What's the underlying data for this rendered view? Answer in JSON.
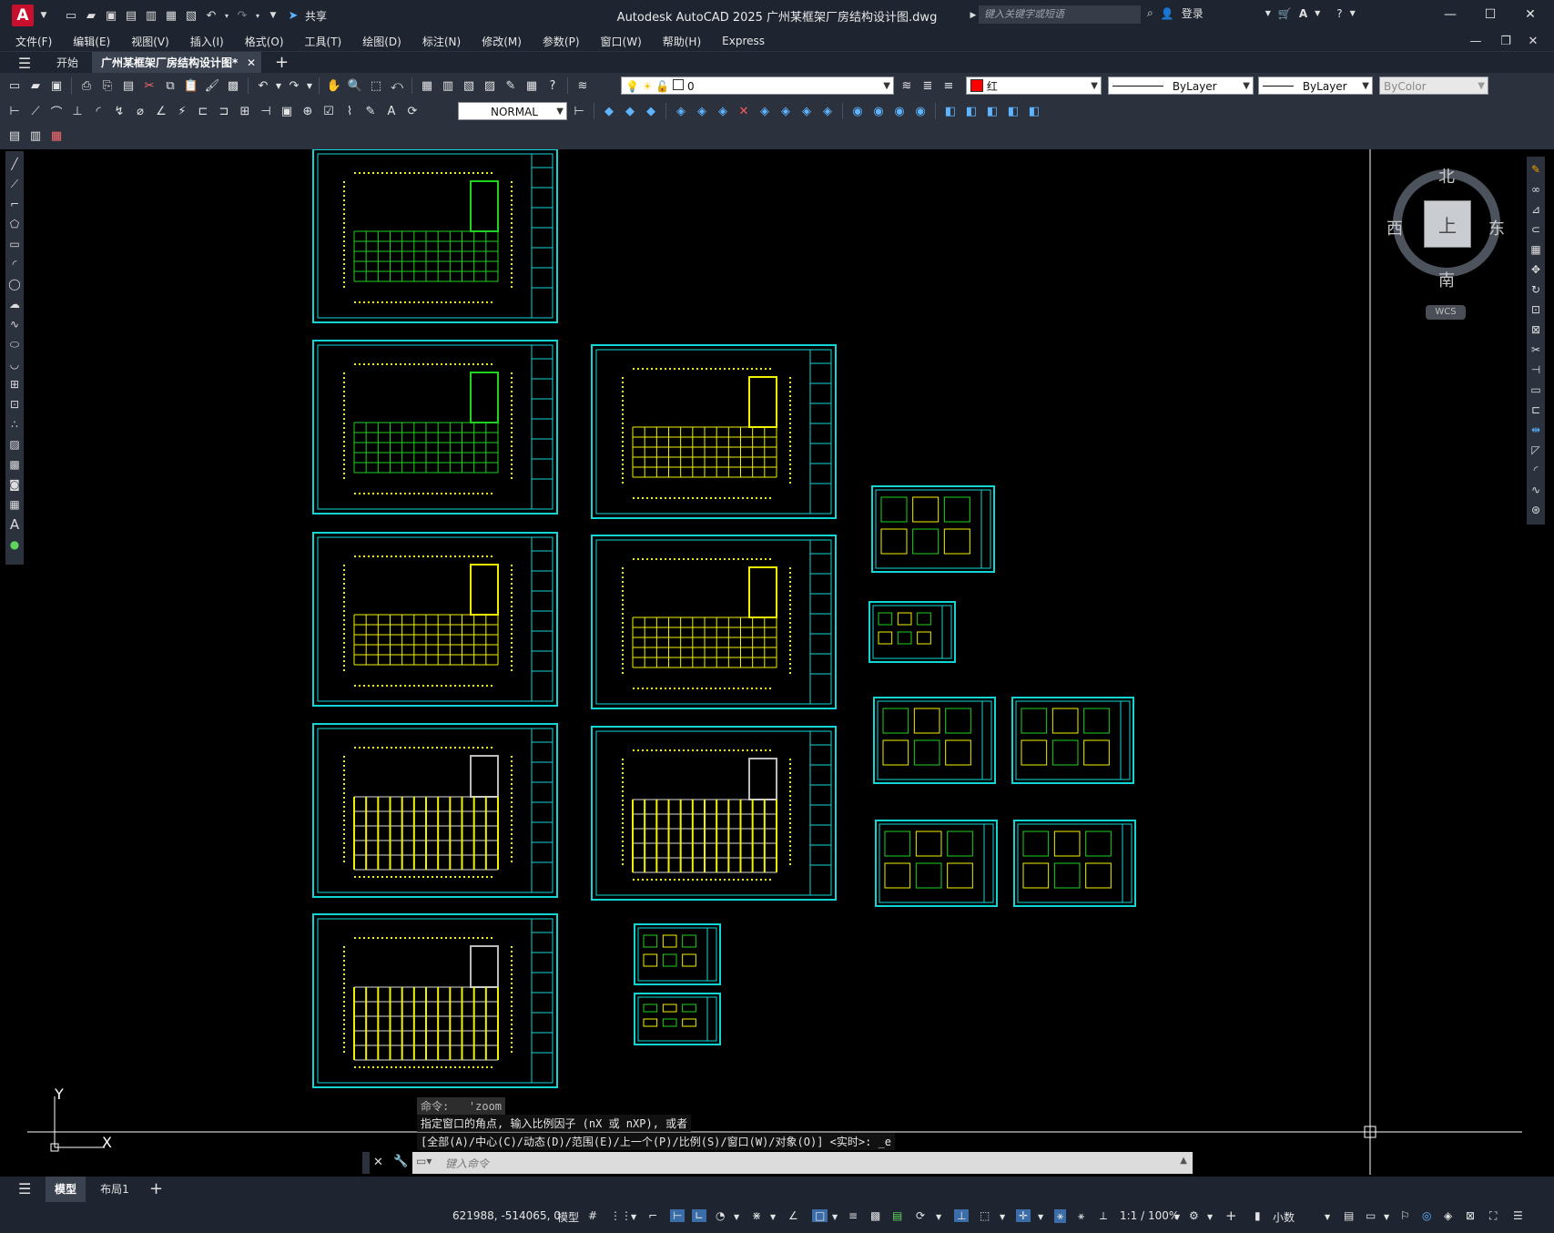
{
  "app": {
    "logo_letter": "A",
    "title": "Autodesk AutoCAD 2025    广州某框架厂房结构设计图.dwg",
    "share_label": "共享",
    "search_placeholder": "键入关键字或短语",
    "login_label": "登录"
  },
  "menu": [
    "文件(F)",
    "编辑(E)",
    "视图(V)",
    "插入(I)",
    "格式(O)",
    "工具(T)",
    "绘图(D)",
    "标注(N)",
    "修改(M)",
    "参数(P)",
    "窗口(W)",
    "帮助(H)",
    "Express"
  ],
  "tabs": {
    "start": "开始",
    "doc": "广州某框架厂房结构设计图*",
    "add": "+"
  },
  "properties": {
    "layer_value": "0",
    "color_value": "红",
    "color_hex": "#ff0000",
    "linetype_value": "ByLayer",
    "lineweight_value": "ByLayer",
    "plotstyle_value": "ByColor",
    "dimstyle_value": "NORMAL"
  },
  "viewcube": {
    "north": "北",
    "south": "南",
    "west": "西",
    "east": "东",
    "face": "上",
    "wcs": "WCS"
  },
  "ucs": {
    "y_label": "Y",
    "x_label": "X"
  },
  "command": {
    "line1": "命令:   'zoom",
    "line2": "指定窗口的角点, 输入比例因子 (nX 或 nXP), 或者",
    "line3": "[全部(A)/中心(C)/动态(D)/范围(E)/上一个(P)/比例(S)/窗口(W)/对象(O)] <实时>: _e",
    "input_placeholder": "键入命令"
  },
  "layout_tabs": {
    "model": "模型",
    "layout1": "布局1",
    "add": "+"
  },
  "status": {
    "coords": "621988, -514065, 0",
    "model_label": "模型",
    "scale": "1:1 / 100%",
    "units": "小数"
  },
  "colors": {
    "frame": "#12d6d6",
    "plan_yellow": "#f2f200",
    "plan_green": "#1fd21f",
    "accent_blue": "#5fb4ff"
  }
}
